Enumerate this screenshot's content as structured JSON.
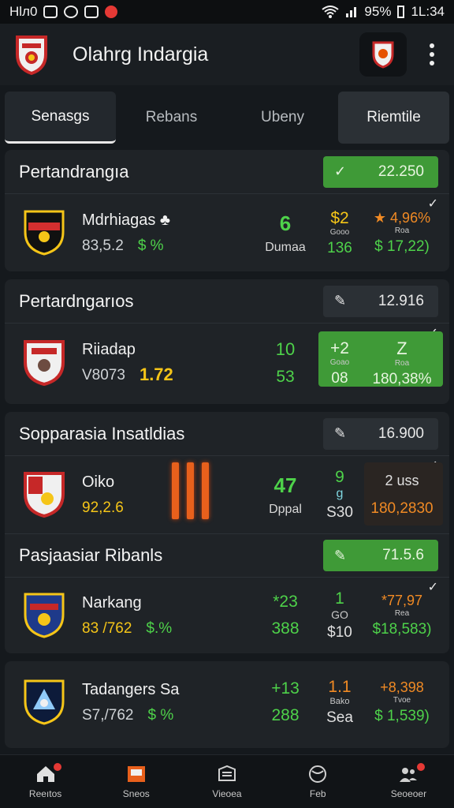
{
  "status_bar": {
    "left_text": "Hlл0",
    "battery": "95%",
    "time": "1L:34"
  },
  "app": {
    "title": "Olahrg Indargia"
  },
  "tabs": [
    {
      "label": "Senasgs"
    },
    {
      "label": "Rebans"
    },
    {
      "label": "Ubeny"
    },
    {
      "label": "Riemtile"
    }
  ],
  "cards": [
    {
      "title": "Pertandrangıa",
      "pill": "22.250",
      "row": {
        "team": "Mdrhiagas ♣",
        "sub1": "83,5.2",
        "sub2": "$ %",
        "mid_top": "6",
        "mid_bot": "Dumaa",
        "odd_a": "$2",
        "odd_s": "Gooo",
        "odd_b": "136",
        "right_a": "★ 4,96%",
        "right_s": "Roa",
        "right_b": "$ 17,22)"
      }
    },
    {
      "title": "Pertardngarıos",
      "pill": "12.916",
      "row": {
        "team": "Riiadap",
        "sub1": "V8073",
        "sub2": "1.72",
        "mid_top": "10",
        "mid_bot": "53",
        "odd_a": "+2",
        "odd_s": "Goao",
        "odd_b": "08",
        "right_a": "Z",
        "right_s": "Roa",
        "right_b": "180,38%"
      }
    },
    {
      "title": "Sopparasia Insatldias",
      "pill": "16.900",
      "row": {
        "team": "Oiko",
        "sub1": "92,2.6",
        "mid_top": "47",
        "mid_bot": "Dppal",
        "odd_a": "9",
        "odd_s": "g",
        "odd_b": "S30",
        "right_a": "2 uss",
        "right_b": "180,2830"
      }
    },
    {
      "title": "Pasjaasiar Ribanls",
      "pill": "71.5.6",
      "row": {
        "team": "Narkang",
        "sub1": "83 /762",
        "sub2": "$.%",
        "mid_top": "*23",
        "mid_bot": "388",
        "odd_a": "1",
        "odd_s": "GO",
        "odd_b": "$10",
        "right_a": "*77,97",
        "right_s": "Rea",
        "right_b": "$18,583)"
      }
    },
    {
      "row": {
        "team": "Tadangers Sa",
        "sub1": "S7,/762",
        "sub2": "$ %",
        "mid_top": "+13",
        "mid_bot": "288",
        "odd_a": "1.1",
        "odd_s": "Bako",
        "odd_b": "Sea",
        "right_a": "+8,398",
        "right_s": "Tvoe",
        "right_b": "$ 1,539)"
      }
    }
  ],
  "nav": [
    {
      "label": "Reeıtos",
      "icon": "home-icon"
    },
    {
      "label": "Sneos",
      "icon": "flag-icon"
    },
    {
      "label": "Vieoea",
      "icon": "stadium-icon"
    },
    {
      "label": "Feb",
      "icon": "ball-icon"
    },
    {
      "label": "Seoeoer",
      "icon": "users-icon"
    }
  ],
  "colors": {
    "green": "#3f9a37",
    "bg": "#15191d",
    "card": "#1f2327"
  }
}
